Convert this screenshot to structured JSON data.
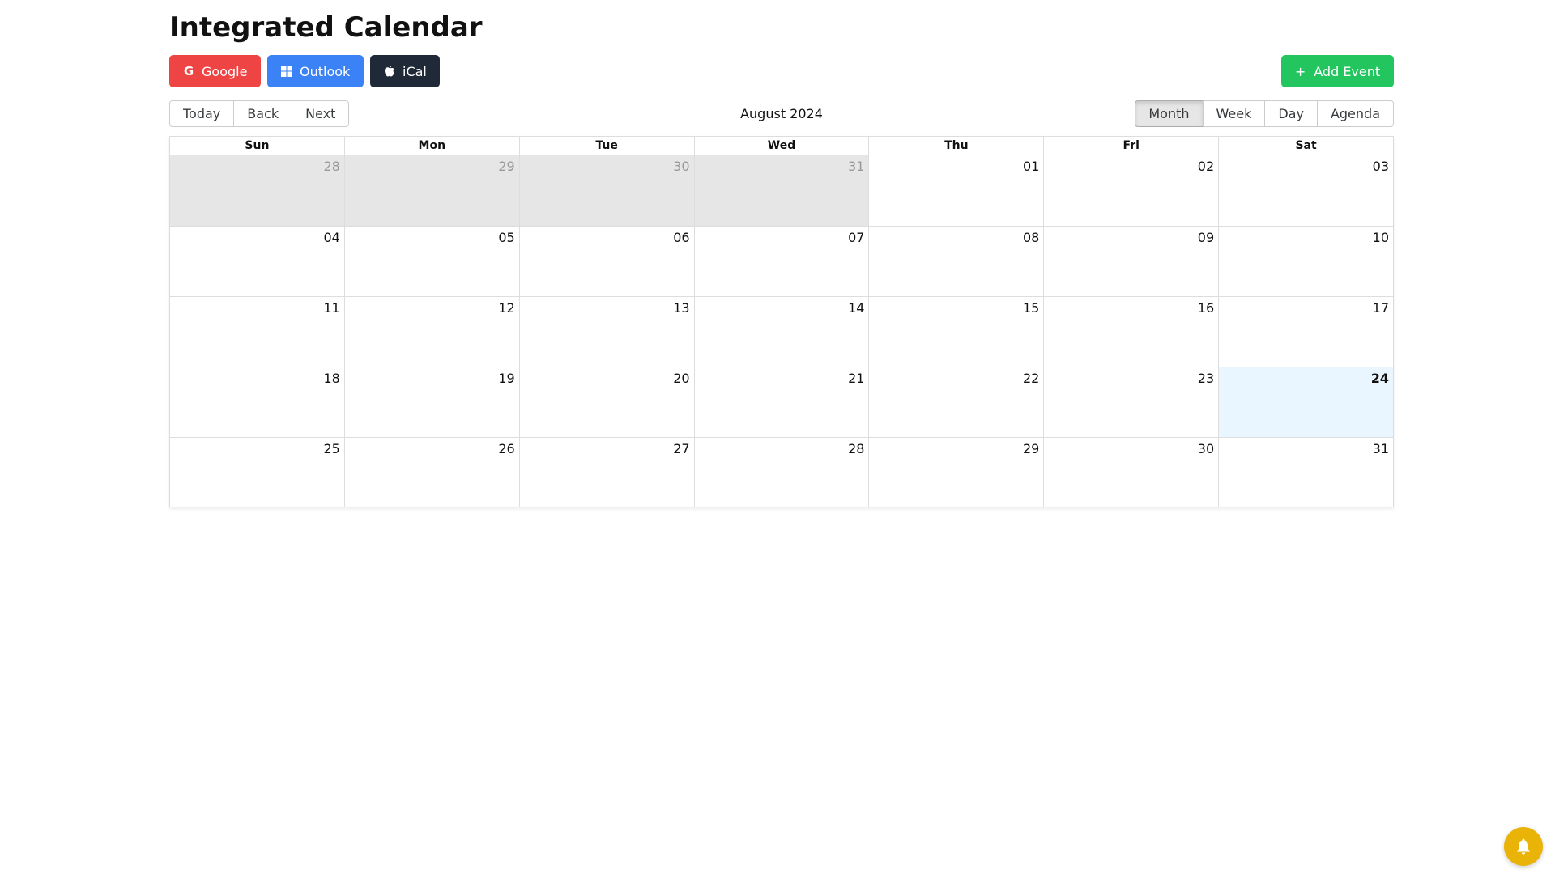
{
  "page": {
    "title": "Integrated Calendar"
  },
  "sync_buttons": {
    "google": {
      "label": "Google",
      "color": "#ef4444",
      "icon": "google-icon"
    },
    "outlook": {
      "label": "Outlook",
      "color": "#3b82f6",
      "icon": "windows-icon"
    },
    "ical": {
      "label": "iCal",
      "color": "#1f2937",
      "icon": "apple-icon"
    }
  },
  "add_event": {
    "label": "Add Event",
    "color": "#22c55e",
    "icon": "plus-icon"
  },
  "toolbar": {
    "nav": {
      "today": "Today",
      "back": "Back",
      "next": "Next"
    },
    "label": "August 2024",
    "views": [
      {
        "label": "Month",
        "active": true
      },
      {
        "label": "Week",
        "active": false
      },
      {
        "label": "Day",
        "active": false
      },
      {
        "label": "Agenda",
        "active": false
      }
    ]
  },
  "calendar": {
    "weekdays": [
      "Sun",
      "Mon",
      "Tue",
      "Wed",
      "Thu",
      "Fri",
      "Sat"
    ],
    "weeks": [
      [
        {
          "date": "28",
          "off": true
        },
        {
          "date": "29",
          "off": true
        },
        {
          "date": "30",
          "off": true
        },
        {
          "date": "31",
          "off": true
        },
        {
          "date": "01"
        },
        {
          "date": "02"
        },
        {
          "date": "03"
        }
      ],
      [
        {
          "date": "04"
        },
        {
          "date": "05"
        },
        {
          "date": "06"
        },
        {
          "date": "07"
        },
        {
          "date": "08"
        },
        {
          "date": "09"
        },
        {
          "date": "10"
        }
      ],
      [
        {
          "date": "11"
        },
        {
          "date": "12"
        },
        {
          "date": "13"
        },
        {
          "date": "14"
        },
        {
          "date": "15"
        },
        {
          "date": "16"
        },
        {
          "date": "17"
        }
      ],
      [
        {
          "date": "18"
        },
        {
          "date": "19"
        },
        {
          "date": "20"
        },
        {
          "date": "21"
        },
        {
          "date": "22"
        },
        {
          "date": "23"
        },
        {
          "date": "24",
          "today": true
        }
      ],
      [
        {
          "date": "25"
        },
        {
          "date": "26"
        },
        {
          "date": "27"
        },
        {
          "date": "28"
        },
        {
          "date": "29"
        },
        {
          "date": "30"
        },
        {
          "date": "31"
        }
      ]
    ],
    "colors": {
      "off_range_bg": "#e6e6e6",
      "today_bg": "#eaf6ff"
    }
  },
  "notification": {
    "icon": "bell-icon",
    "color": "#eab308"
  }
}
